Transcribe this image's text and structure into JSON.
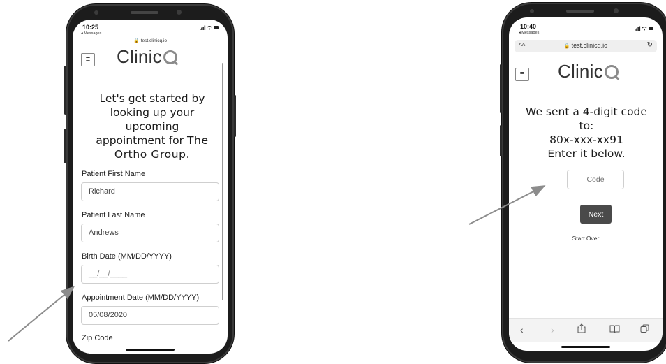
{
  "left_phone": {
    "status": {
      "time": "10:25",
      "back_label": "◂ Messages",
      "icons": "📶 ≈ ▬"
    },
    "url": "test.clinicq.io",
    "logo": "Clinic",
    "intro": [
      "Let's get started by",
      "looking up your",
      "upcoming",
      "appointment for"
    ],
    "intro_org_line1": "The",
    "intro_org_line2": "Ortho Group.",
    "fields": [
      {
        "label": "Patient First Name",
        "value": "Richard"
      },
      {
        "label": "Patient Last Name",
        "value": "Andrews"
      },
      {
        "label": "Birth Date (MM/DD/YYYY)",
        "value": "__/__/____"
      },
      {
        "label": "Appointment Date (MM/DD/YYYY)",
        "value": "05/08/2020"
      },
      {
        "label": "Zip Code",
        "value": ""
      }
    ]
  },
  "right_phone": {
    "status": {
      "time": "10:40",
      "back_label": "◂ Messages",
      "icons": "📶 ≈ ▬"
    },
    "safari": {
      "aa": "AA",
      "url": "test.clinicq.io",
      "reload": "↻"
    },
    "logo": "Clinic",
    "message": [
      "We sent a 4-digit code",
      "to:",
      "80x-xxx-xx91",
      "Enter it below."
    ],
    "code_placeholder": "Code",
    "next_label": "Next",
    "start_over": "Start Over",
    "toolbar": {
      "back": "‹",
      "forward": "›",
      "share": "⇧",
      "bookmarks": "📖",
      "tabs": "⧉"
    }
  },
  "colors": {
    "arrow": "#8c8c8c",
    "button": "#4a4a4a",
    "phone_frame": "#1c1c1c"
  }
}
